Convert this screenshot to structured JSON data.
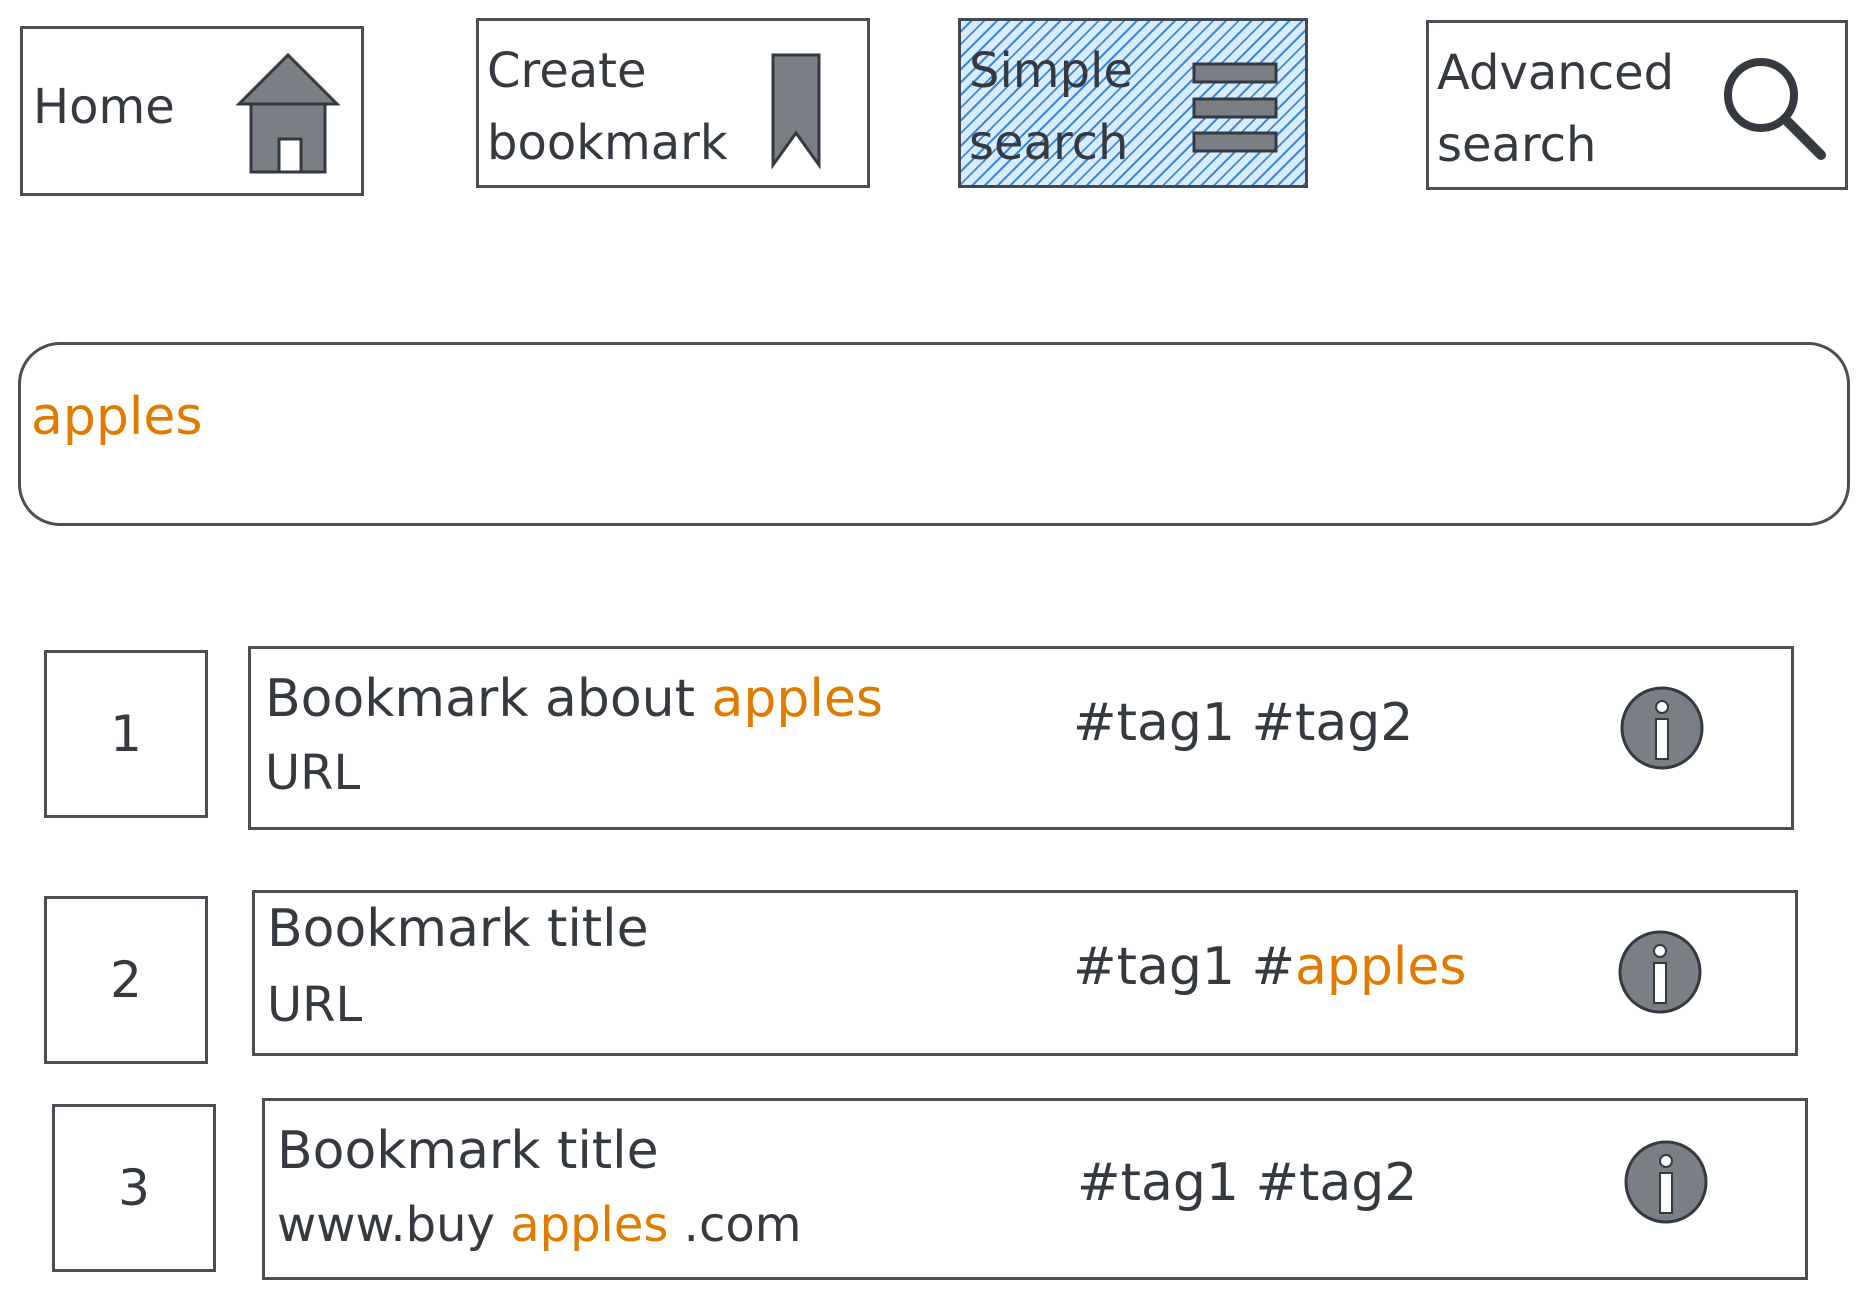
{
  "toolbar": {
    "home_label": "Home",
    "create_label": "Create\nbookmark",
    "simple_search_label": "Simple\nsearch",
    "advanced_search_label": "Advanced\nsearch"
  },
  "search": {
    "value": "apples"
  },
  "results": [
    {
      "index": "1",
      "title_prefix": "Bookmark about ",
      "title_highlight": "apples",
      "url_prefix": "URL",
      "url_highlight": "",
      "url_suffix": "",
      "tags_prefix": "#tag1 #tag2",
      "tags_highlight": ""
    },
    {
      "index": "2",
      "title_prefix": "Bookmark title",
      "title_highlight": "",
      "url_prefix": "URL",
      "url_highlight": "",
      "url_suffix": "",
      "tags_prefix": "#tag1 #",
      "tags_highlight": "apples"
    },
    {
      "index": "3",
      "title_prefix": "Bookmark title",
      "title_highlight": "",
      "url_prefix": "www.buy ",
      "url_highlight": "apples",
      "url_suffix": " .com",
      "tags_prefix": "#tag1 #tag2",
      "tags_highlight": ""
    }
  ],
  "colors": {
    "highlight": "#e07b00",
    "active_fill": "#3b8bd8",
    "ink": "#343a40",
    "icon_fill": "#7a7f85"
  },
  "icons": {
    "home": "house-icon",
    "create": "bookmark-icon",
    "simple_search": "hamburger-menu-icon",
    "advanced_search": "magnifier-icon",
    "info": "info-icon"
  }
}
